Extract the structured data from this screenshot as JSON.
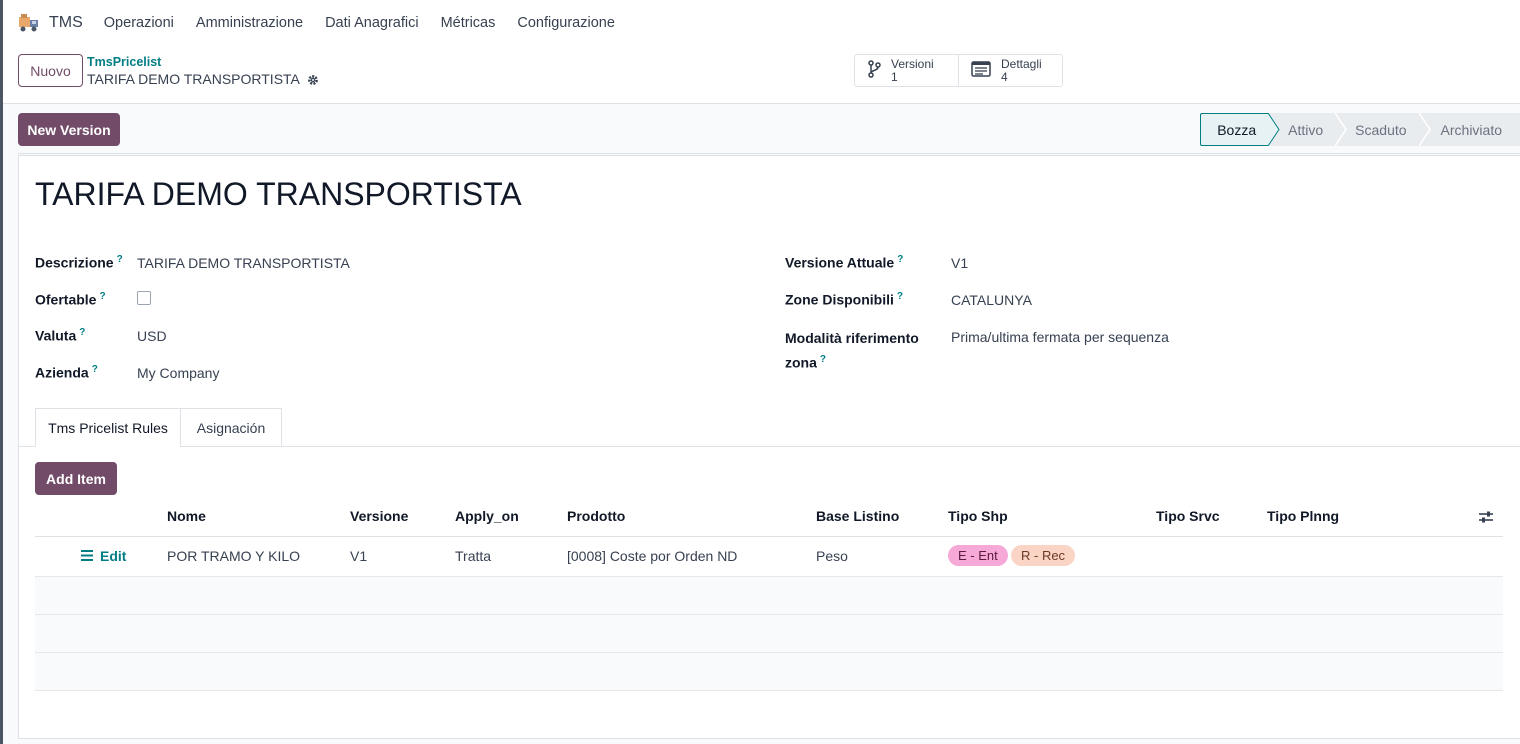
{
  "app": {
    "name": "TMS",
    "menu": [
      "Operazioni",
      "Amministrazione",
      "Dati Anagrafici",
      "Métricas",
      "Configurazione"
    ]
  },
  "control": {
    "new_button": "Nuovo",
    "breadcrumb_parent": "TmsPricelist",
    "breadcrumb_current": "TARIFA DEMO TRANSPORTISTA",
    "smart_buttons": [
      {
        "label": "Versioni",
        "value": "1",
        "icon": "branch-icon"
      },
      {
        "label": "Dettagli",
        "value": "4",
        "icon": "list-details-icon"
      }
    ]
  },
  "statusbar": {
    "new_version_button": "New Version",
    "stages": [
      "Bozza",
      "Attivo",
      "Scaduto",
      "Archiviato"
    ],
    "active_stage": "Bozza"
  },
  "form": {
    "title": "TARIFA DEMO TRANSPORTISTA",
    "help_mark": "?",
    "left_fields": [
      {
        "label": "Descrizione",
        "value": "TARIFA DEMO TRANSPORTISTA"
      },
      {
        "label": "Ofertable",
        "value": false
      },
      {
        "label": "Valuta",
        "value": "USD"
      },
      {
        "label": "Azienda",
        "value": "My Company"
      }
    ],
    "right_fields": [
      {
        "label": "Versione Attuale",
        "value": "V1"
      },
      {
        "label": "Zone Disponibili",
        "value": "CATALUNYA"
      },
      {
        "label_line1": "Modalità riferimento",
        "label_line2": "zona",
        "value": "Prima/ultima fermata per sequenza"
      }
    ]
  },
  "tabs": [
    "Tms Pricelist Rules",
    "Asignación"
  ],
  "rules": {
    "add_button": "Add Item",
    "columns": [
      "Nome",
      "Versione",
      "Apply_on",
      "Prodotto",
      "Base Listino",
      "Tipo Shp",
      "Tipo Srvc",
      "Tipo Plnng"
    ],
    "rows": [
      {
        "edit_label": "Edit",
        "nome": "POR TRAMO Y KILO",
        "versione": "V1",
        "apply_on": "Tratta",
        "prodotto": "[0008] Coste por Orden ND",
        "base_listino": "Peso",
        "tipo_shp": [
          "E - Ent",
          "R - Rec"
        ],
        "tipo_srvc": "",
        "tipo_plnng": ""
      }
    ]
  },
  "colors": {
    "primary": "#714b67",
    "teal": "#017e84",
    "tag_ent_bg": "#f6a8d6",
    "tag_rec_bg": "#fad4c4"
  }
}
